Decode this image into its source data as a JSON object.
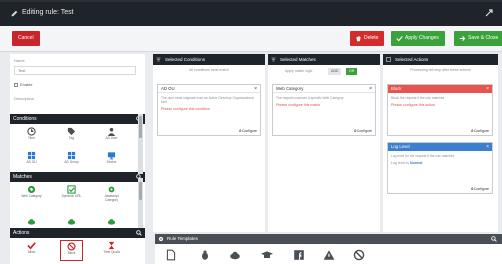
{
  "window": {
    "title": "Editing rule: Test"
  },
  "toolbar": {
    "cancel_label": "Cancel",
    "delete_label": "Delete",
    "apply_label": "Apply Changes",
    "save_label": "Save & Close"
  },
  "colors": {
    "danger": "#c9252c",
    "success": "#3ba13c",
    "header": "#1f242a",
    "block": "#e5544d",
    "log": "#3d7fcf"
  },
  "form": {
    "name_label": "Name",
    "name_value": "Test",
    "enable_label": "Enable",
    "description_label": "Description"
  },
  "sections": {
    "conditions": {
      "title": "Conditions",
      "items": [
        {
          "label": "Time",
          "icon": "clock-icon"
        },
        {
          "label": "Tag",
          "icon": "tag-icon"
        },
        {
          "label": "AD User",
          "icon": "user-icon"
        },
        {
          "label": "AD OU",
          "icon": "windows-icon"
        },
        {
          "label": "AD Group",
          "icon": "windows-icon"
        },
        {
          "label": "Device",
          "icon": "monitor-icon"
        }
      ]
    },
    "matches": {
      "title": "Matches",
      "items": [
        {
          "label": "Web Category",
          "icon": "globe-icon"
        },
        {
          "label": "Dynamic URL",
          "icon": "checkbox-icon"
        },
        {
          "label": "Javascript Category",
          "icon": "gear-icon"
        }
      ]
    },
    "actions": {
      "title": "Actions",
      "items": [
        {
          "label": "Allow",
          "icon": "check-icon"
        },
        {
          "label": "Block",
          "icon": "block-icon"
        },
        {
          "label": "Time Quota",
          "icon": "hourglass-icon"
        }
      ]
    }
  },
  "columns": {
    "conditions": {
      "title": "Selected Conditions",
      "subtitle": "All conditions must match",
      "card": {
        "title": "AD OU",
        "desc": "The user must originate from an Active Directory Organizational Unit",
        "warn": "Please configure this condition",
        "configure": "Configure"
      }
    },
    "matches": {
      "title": "Selected Matches",
      "logic_label": "Apply match logic",
      "and_label": "AND",
      "or_label": "OR",
      "card": {
        "title": "Web Category",
        "desc": "The request matches a specific Web Category",
        "warn": "Please configure this match",
        "configure": "Configure"
      }
    },
    "actions": {
      "title": "Selected Actions",
      "subtitle": "Processing will stop after these actions",
      "block_card": {
        "title": "Block",
        "desc": "Block the request if the rule matches",
        "warn": "Please configure this action",
        "configure": "Configure"
      },
      "log_card": {
        "title": "Log Level",
        "desc": "Log level for the request if the rule matches",
        "level_label": "Log level is",
        "level_value": "Normal",
        "configure": "Configure"
      }
    }
  },
  "templates": {
    "title": "Rule Templates",
    "icons": [
      "document-icon",
      "bug-icon",
      "cloud-icon",
      "graduation-cap-icon",
      "facebook-icon",
      "warning-icon",
      "block-icon"
    ]
  }
}
